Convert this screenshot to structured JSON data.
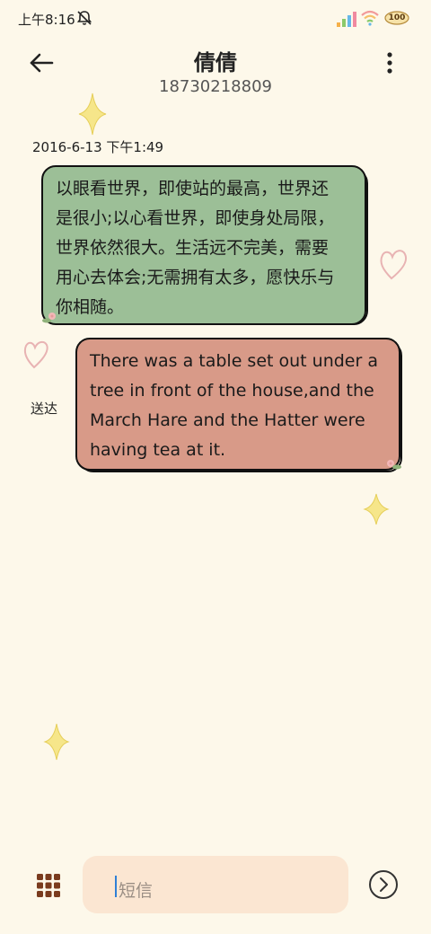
{
  "status_bar": {
    "time": "上午8:16",
    "battery": "100"
  },
  "header": {
    "contact_name": "倩倩",
    "phone_number": "18730218809"
  },
  "conversation": {
    "timestamp": "2016-6-13 下午1:49",
    "messages": [
      {
        "direction": "incoming",
        "lines": [
          "以眼看世界，即使站的最高，世界还",
          "是很小;以心看世界，即使身处局限，",
          "世界依然很大。生活远不完美，需要",
          "用心去体会;无需拥有太多，愿快乐与",
          "你相随。"
        ]
      },
      {
        "direction": "outgoing",
        "lines": [
          "There was a table set out under a",
          "tree in front of the house,and the",
          "March Hare and the Hatter were",
          "having tea at it."
        ],
        "status": "送达"
      }
    ]
  },
  "composer": {
    "placeholder": "短信"
  },
  "colors": {
    "background": "#fdf8ea",
    "incoming_bubble": "#9cbf97",
    "outgoing_bubble": "#d89a88",
    "input_background": "#fbe6d2",
    "cursor": "#2f7fd6"
  }
}
